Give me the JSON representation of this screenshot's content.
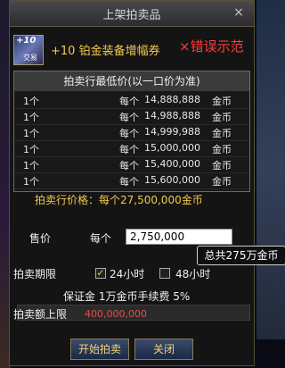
{
  "window": {
    "title": "上架拍卖品",
    "close_label": "×"
  },
  "item": {
    "icon_top": "+10",
    "icon_tag": "交易",
    "name": "+10 铂金装备增幅券"
  },
  "watermark": "×错误示范",
  "panel": {
    "header": "拍卖行最低价(以一口价为准)",
    "rows": [
      {
        "qty": "1个",
        "each": "每个",
        "price": "14,888,888",
        "currency": "金币"
      },
      {
        "qty": "1个",
        "each": "每个",
        "price": "14,988,888",
        "currency": "金币"
      },
      {
        "qty": "1个",
        "each": "每个",
        "price": "14,999,988",
        "currency": "金币"
      },
      {
        "qty": "1个",
        "each": "每个",
        "price": "15,000,000",
        "currency": "金币"
      },
      {
        "qty": "1个",
        "each": "每个",
        "price": "15,400,000",
        "currency": "金币"
      },
      {
        "qty": "1个",
        "each": "每个",
        "price": "15,600,000",
        "currency": "金币"
      }
    ]
  },
  "reference_price": "拍卖行价格：每个27,500,000金币",
  "price": {
    "label": "售价",
    "each_label": "每个",
    "value": "2,750,000"
  },
  "tooltip": "总共275万金币",
  "period": {
    "label": "拍卖期限",
    "opt1": "24小时",
    "opt1_checked": true,
    "opt2": "48小时",
    "opt2_checked": false
  },
  "deposit": "保证金  1万金币手续费  5%",
  "limit": {
    "label": "拍卖额上限",
    "value": "400,000,000"
  },
  "buttons": {
    "start": "开始拍卖",
    "close": "关闭"
  },
  "colors": {
    "gold": "#f2c94c",
    "warning_red": "#ff3b3b",
    "limit_red": "#e05050"
  }
}
